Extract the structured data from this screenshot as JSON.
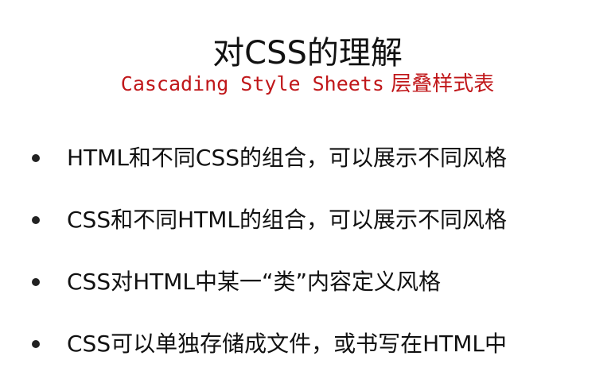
{
  "slide": {
    "title": "对CSS的理解",
    "subtitle_en": "Cascading Style Sheets",
    "subtitle_cn": "层叠样式表",
    "bullets": [
      "HTML和不同CSS的组合，可以展示不同风格",
      "CSS和不同HTML的组合，可以展示不同风格",
      "CSS对HTML中某一“类”内容定义风格",
      "CSS可以单独存储成文件，或书写在HTML中"
    ]
  },
  "colors": {
    "subtitle": "#c0171a",
    "text": "#111111",
    "background": "#ffffff"
  }
}
